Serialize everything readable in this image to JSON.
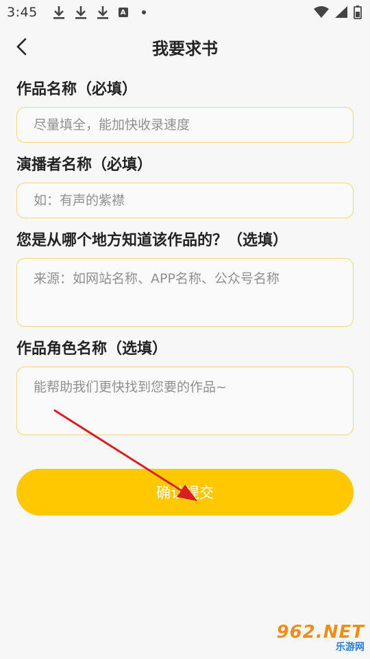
{
  "status_bar": {
    "time": "3:45",
    "icons": [
      "download-icon",
      "download-icon",
      "download-icon",
      "a-badge-icon",
      "dot-icon",
      "wifi-icon",
      "signal-icon",
      "battery-icon"
    ],
    "badge_letter": "A"
  },
  "header": {
    "title": "我要求书",
    "back_icon": "chevron-left-icon"
  },
  "form": {
    "work_name": {
      "label": "作品名称（必填）",
      "placeholder": "尽量填全，能加快收录速度",
      "value": ""
    },
    "narrator": {
      "label": "演播者名称（必填）",
      "placeholder": "如：有声的紫襟",
      "value": ""
    },
    "source": {
      "label": "您是从哪个地方知道该作品的？（选填）",
      "placeholder": "来源：如网站名称、APP名称、公众号名称",
      "value": ""
    },
    "characters": {
      "label": "作品角色名称（选填）",
      "placeholder": "能帮助我们更快找到您要的作品~",
      "value": ""
    }
  },
  "submit_label": "确认提交",
  "colors": {
    "accent": "#ffc800",
    "field_border": "#f3d77a",
    "background": "#f7f7f7",
    "annotation_arrow": "#d81e1e"
  },
  "watermark": {
    "main": "962.NET",
    "sub": "乐游网"
  }
}
